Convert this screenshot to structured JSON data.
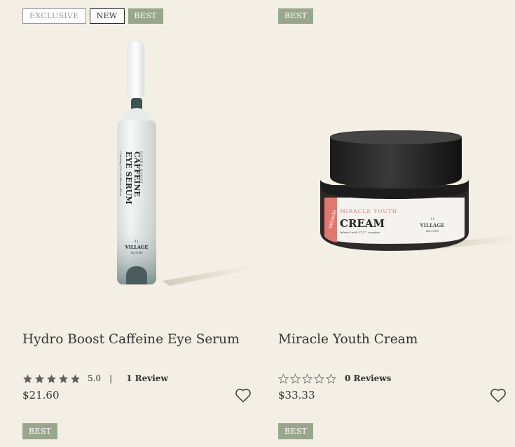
{
  "products": [
    {
      "badges": [
        "EXCLUSIVE",
        "NEW",
        "BEST"
      ],
      "name": "Hydro Boost Caffeine Eye Serum",
      "rating_value": "5.0",
      "rating_separator": "|",
      "rating_stars": 5,
      "reviews": "1 Review",
      "price": "$21.60",
      "image": {
        "brand_lines": [
          "HYDRO BOOST",
          "CAFFEINE",
          "EYE SERUM"
        ],
        "sub_text": "Containing 10% of Caffeine solution",
        "logo": [
          "· 11 ·",
          "VILLAGE",
          "FACTORY"
        ]
      }
    },
    {
      "badges": [
        "BEST"
      ],
      "name": "Miracle Youth Cream",
      "rating_stars": 0,
      "reviews": "0 Reviews",
      "price": "$33.33",
      "image": {
        "label_top": "MIRACLE YOUTH",
        "label_main": "CREAM",
        "sub_text": "Infused with V11™ complex",
        "logo": [
          "· 11 ·",
          "VILLAGE",
          "FACTORY"
        ]
      }
    }
  ],
  "next_row_badges": [
    "BEST",
    "BEST"
  ],
  "colors": {
    "badge_best": "#98a78d",
    "background": "#f4efe4",
    "star_filled": "#5f5f5f"
  }
}
